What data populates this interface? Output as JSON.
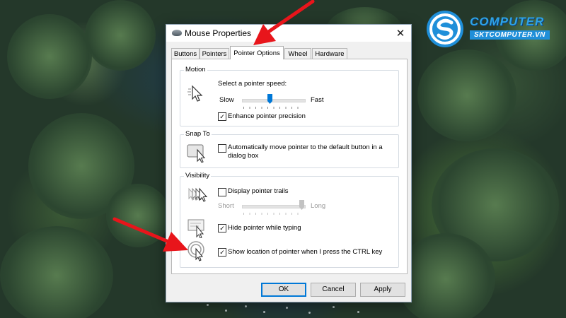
{
  "window": {
    "title": "Mouse Properties",
    "close_glyph": "✕"
  },
  "tabs": [
    {
      "label": "Buttons"
    },
    {
      "label": "Pointers"
    },
    {
      "label": "Pointer Options",
      "selected": true
    },
    {
      "label": "Wheel"
    },
    {
      "label": "Hardware"
    }
  ],
  "motion": {
    "group_label": "Motion",
    "prompt": "Select a pointer speed:",
    "slow_label": "Slow",
    "fast_label": "Fast",
    "speed_level": 0.44,
    "enhance_precision_label": "Enhance pointer precision",
    "enhance_precision_checked": true
  },
  "snap_to": {
    "group_label": "Snap To",
    "auto_move_label": "Automatically move pointer to the default button in a dialog box",
    "auto_move_label_line1": "Automatically move pointer to the default button in a",
    "auto_move_label_line2": "dialog box",
    "auto_move_checked": false
  },
  "visibility": {
    "group_label": "Visibility",
    "trails_label": "Display pointer trails",
    "trails_checked": false,
    "short_label": "Short",
    "long_label": "Long",
    "trail_length_level": 1.0,
    "hide_typing_label": "Hide pointer while typing",
    "hide_typing_checked": true,
    "show_location_label": "Show location of pointer when I press the CTRL key",
    "show_location_checked": true
  },
  "buttons": {
    "ok": "OK",
    "cancel": "Cancel",
    "apply": "Apply"
  },
  "logo": {
    "brand": "COMPUTER",
    "site": "SKTCOMPUTER.VN"
  },
  "icons": [
    "mouse-icon",
    "pointer-speed-icon",
    "snap-to-icon",
    "pointer-trails-icon",
    "hide-pointer-icon",
    "pointer-location-icon"
  ],
  "colors": {
    "accent": "#0078d7",
    "annotation_arrow": "#e8151b",
    "logo_blue": "#1f8fd9"
  }
}
